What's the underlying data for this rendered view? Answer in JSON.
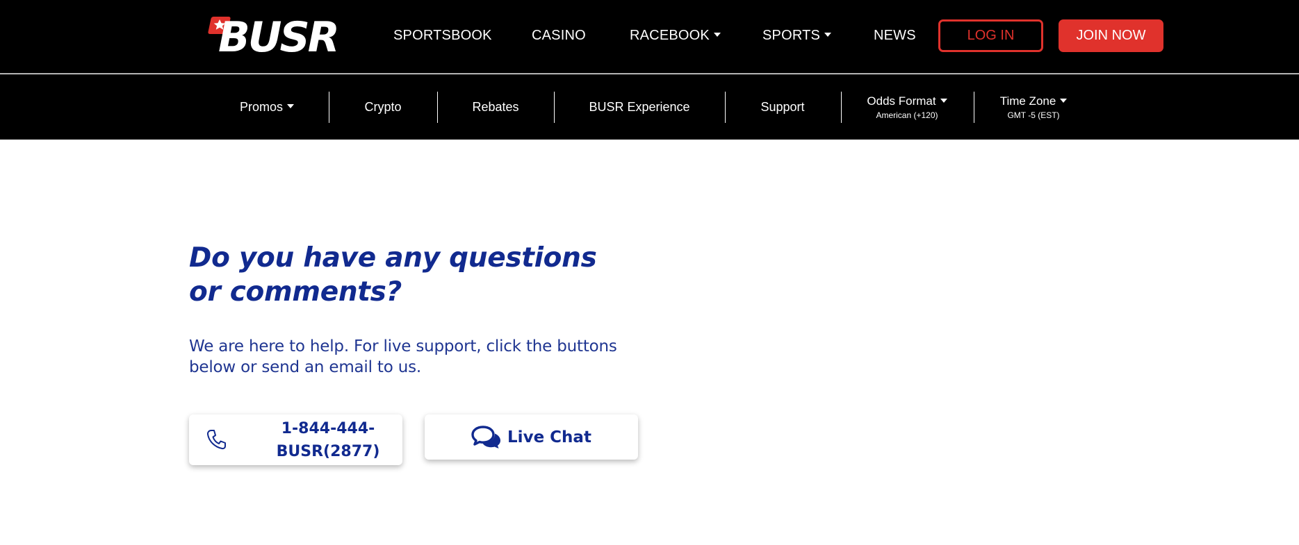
{
  "header": {
    "logo_text": "BUSR",
    "nav": [
      {
        "label": "SPORTSBOOK"
      },
      {
        "label": "CASINO"
      },
      {
        "label": "RACEBOOK"
      },
      {
        "label": "SPORTS"
      },
      {
        "label": "NEWS"
      }
    ],
    "login_label": "LOG IN",
    "join_label": "JOIN NOW"
  },
  "subnav": {
    "items": [
      {
        "label": "Promos"
      },
      {
        "label": "Crypto"
      },
      {
        "label": "Rebates"
      },
      {
        "label": "BUSR Experience"
      },
      {
        "label": "Support"
      }
    ],
    "odds_format": {
      "label": "Odds Format",
      "value": "American (+120)"
    },
    "time_zone": {
      "label": "Time Zone",
      "value": "GMT -5 (EST)"
    }
  },
  "main": {
    "headline": "Do you have any questions or comments?",
    "body": "We are here to help. For live support, click the buttons below or send an email to us.",
    "phone_label": "1-844-444-BUSR(2877)",
    "chat_label": "Live Chat"
  },
  "colors": {
    "brand_red": "#e0322c",
    "heading_blue": "#112a8f",
    "bar_background": "#000000"
  }
}
